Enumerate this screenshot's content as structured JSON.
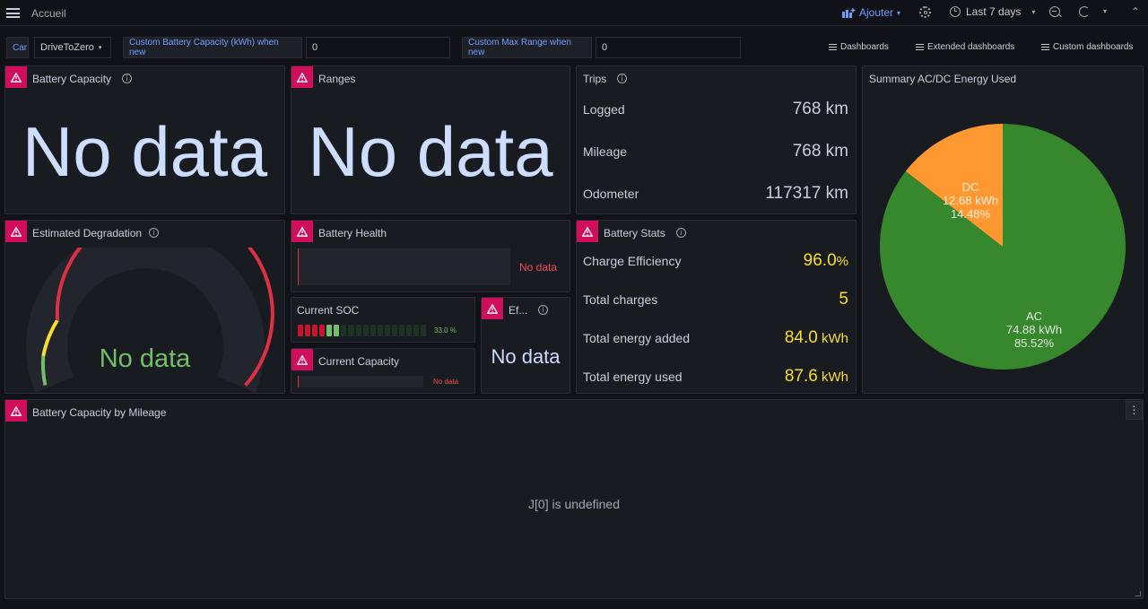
{
  "topbar": {
    "breadcrumb": "Accueil",
    "add_label": "Ajouter",
    "time_range": "Last 7 days"
  },
  "variables": {
    "car_label": "Car",
    "car_value": "DriveToZero",
    "capacity_label": "Custom Battery Capacity (kWh) when new",
    "capacity_value": "0",
    "range_label": "Custom Max Range when new",
    "range_value": "0"
  },
  "dash_links": [
    "Dashboards",
    "Extended dashboards",
    "Custom dashboards"
  ],
  "panels": {
    "battery_capacity": {
      "title": "Battery Capacity",
      "value": "No data"
    },
    "ranges": {
      "title": "Ranges",
      "value": "No data"
    },
    "trips": {
      "title": "Trips",
      "rows": [
        {
          "label": "Logged",
          "value": "768 km"
        },
        {
          "label": "Mileage",
          "value": "768 km"
        },
        {
          "label": "Odometer",
          "value": "117317 km"
        }
      ]
    },
    "summary": {
      "title": "Summary AC/DC Energy Used",
      "slices": [
        {
          "name": "AC",
          "kwh": "74.88 kWh",
          "percent": "85.52%",
          "share": 0.8552,
          "color": "#37872d"
        },
        {
          "name": "DC",
          "kwh": "12.68 kWh",
          "percent": "14.48%",
          "share": 0.1448,
          "color": "#ff9830"
        }
      ]
    },
    "degradation": {
      "title": "Estimated Degradation",
      "value": "No data"
    },
    "battery_health": {
      "title": "Battery Health",
      "value": "No data"
    },
    "current_soc": {
      "title": "Current SOC",
      "value": "33.0 %",
      "level": 0.33
    },
    "current_capacity": {
      "title": "Current Capacity",
      "value": "No data"
    },
    "efficiency": {
      "title": "Ef...",
      "value": "No data"
    },
    "battery_stats": {
      "title": "Battery Stats",
      "rows": [
        {
          "label": "Charge Efficiency",
          "value": "96.0",
          "unit": "%"
        },
        {
          "label": "Total charges",
          "value": "5",
          "unit": ""
        },
        {
          "label": "Total energy added",
          "value": "84.0",
          "unit": " kWh"
        },
        {
          "label": "Total energy used",
          "value": "87.6",
          "unit": " kWh"
        }
      ]
    },
    "capacity_by_mileage": {
      "title": "Battery Capacity by Mileage",
      "error": "J[0] is undefined"
    }
  },
  "colors": {
    "error": "#d10e5c",
    "yellow": "#fade2a",
    "green": "#73bf69",
    "ac": "#37872d",
    "dc": "#ff9830"
  }
}
